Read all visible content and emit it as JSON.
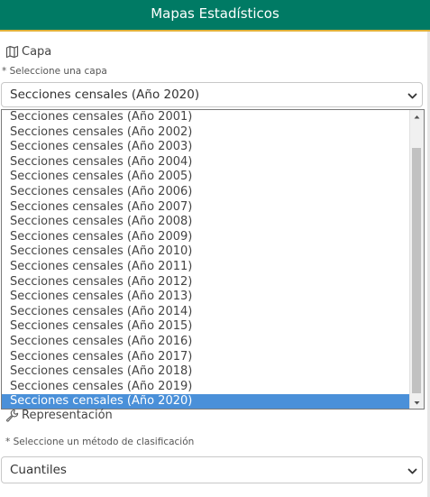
{
  "header": {
    "title": "Mapas Estadísticos",
    "bg_color": "#007a64",
    "accent_color": "#e0b13a"
  },
  "capa": {
    "label": "Capa",
    "icon": "map-icon",
    "hint": "* Seleccione una capa",
    "selected": "Secciones censales (Año 2020)"
  },
  "dropdown": {
    "options": [
      "Secciones censales (Año 2001)",
      "Secciones censales (Año 2002)",
      "Secciones censales (Año 2003)",
      "Secciones censales (Año 2004)",
      "Secciones censales (Año 2005)",
      "Secciones censales (Año 2006)",
      "Secciones censales (Año 2007)",
      "Secciones censales (Año 2008)",
      "Secciones censales (Año 2009)",
      "Secciones censales (Año 2010)",
      "Secciones censales (Año 2011)",
      "Secciones censales (Año 2012)",
      "Secciones censales (Año 2013)",
      "Secciones censales (Año 2014)",
      "Secciones censales (Año 2015)",
      "Secciones censales (Año 2016)",
      "Secciones censales (Año 2017)",
      "Secciones censales (Año 2018)",
      "Secciones censales (Año 2019)",
      "Secciones censales (Año 2020)"
    ],
    "selected_index": 19,
    "highlight_color": "#4a90d9"
  },
  "representacion": {
    "label": "Representación",
    "icon": "wrench-icon",
    "hint": "* Seleccione un método de clasificación",
    "selected": "Cuantiles"
  }
}
